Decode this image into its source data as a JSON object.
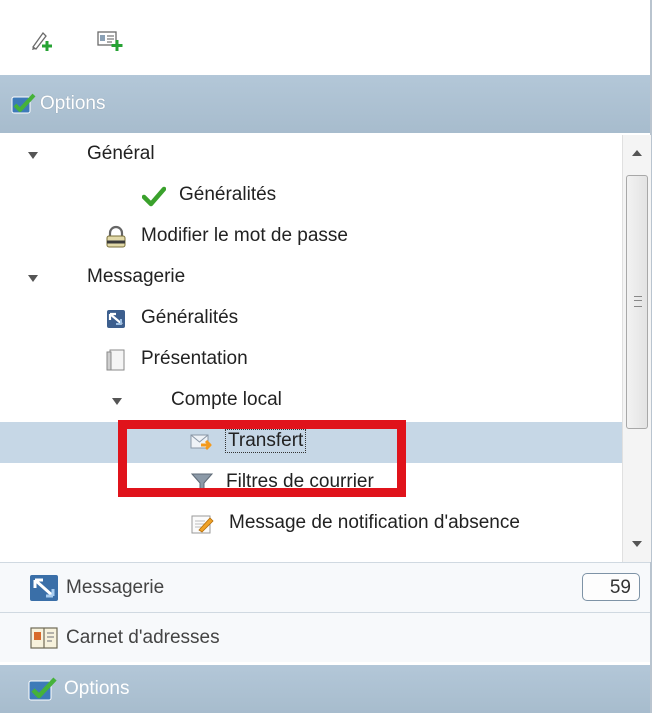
{
  "toolbar": {
    "buttons": [
      {
        "icon": "new-item-icon"
      },
      {
        "icon": "new-card-icon"
      }
    ]
  },
  "options_header": {
    "title": "Options",
    "icon": "options-checkmark-icon"
  },
  "tree": {
    "items": [
      {
        "label": "Général",
        "expanded": true,
        "level": 0
      },
      {
        "label": "Généralités",
        "icon": "green-check-icon",
        "level": 1
      },
      {
        "label": "Modifier le mot de passe",
        "icon": "password-lock-icon",
        "level": 1
      },
      {
        "label": "Messagerie",
        "expanded": true,
        "level": 0
      },
      {
        "label": "Généralités",
        "icon": "mail-general-icon",
        "level": 1
      },
      {
        "label": "Présentation",
        "icon": "document-icon",
        "level": 1
      },
      {
        "label": "Compte local",
        "expanded": true,
        "level": 1
      },
      {
        "label": "Transfert",
        "icon": "forward-mail-icon",
        "level": 2,
        "selected": true
      },
      {
        "label": "Filtres de courrier",
        "icon": "filter-funnel-icon",
        "level": 2
      },
      {
        "label": "Message de notification d'absence",
        "icon": "absence-note-icon",
        "level": 2
      }
    ]
  },
  "nav": {
    "messagerie": {
      "label": "Messagerie",
      "badge": "59"
    },
    "carnet": {
      "label": "Carnet d'adresses"
    },
    "options": {
      "label": "Options"
    }
  },
  "colors": {
    "header_bg": "#aec2d3",
    "selected_row": "#c6d7e6",
    "annotation_red": "#e0131b"
  }
}
